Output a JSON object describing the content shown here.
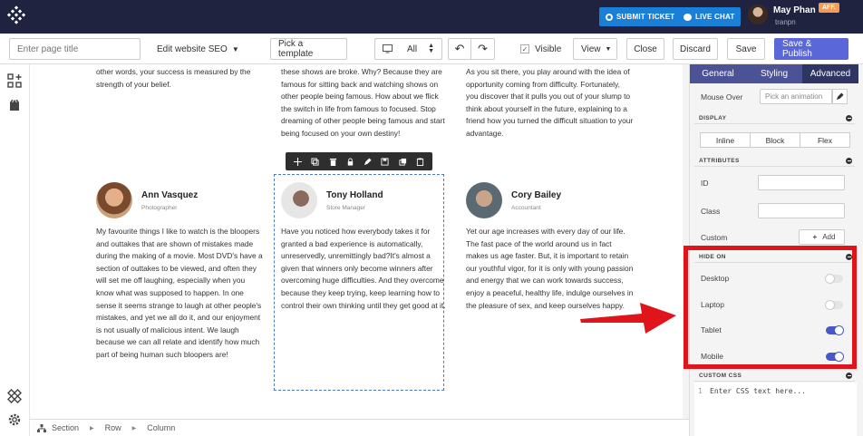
{
  "header": {
    "submit_ticket": "SUBMIT TICKET",
    "live_chat": "LIVE CHAT",
    "user_name": "May Phan",
    "user_handle": "tranpn",
    "badge": "AFF."
  },
  "toolbar": {
    "page_title_placeholder": "Enter page title",
    "seo_label": "Edit website SEO",
    "template_label": "Pick a template",
    "device_label": "All",
    "visible_label": "Visible",
    "view_label": "View",
    "close_label": "Close",
    "discard_label": "Discard",
    "save_label": "Save",
    "save_publish_label": "Save & Publish"
  },
  "content": {
    "columns": [
      {
        "intro": "other words, your success is measured by the strength of your belief.",
        "name": "Ann Vasquez",
        "role": "Photographer",
        "body": "My favourite things I like to watch is the bloopers and outtakes that are shown of mistakes made during the making of a movie. Most DVD's have a section of outtakes to be viewed, and often they will set me off laughing, especially when you know what was supposed to happen. In one sense it seems strange to laugh at other people's mistakes, and yet we all do it, and our enjoyment is not usually of malicious intent. We laugh because we can all relate and identify how much part of being human such bloopers are!"
      },
      {
        "intro": "these shows are broke. Why? Because they are famous for sitting back and watching shows on other people being famous. How about we flick the switch in life from famous to focused. Stop dreaming of other people being famous and start being focused on your own destiny!",
        "name": "Tony Holland",
        "role": "Store Manager",
        "body": "Have you noticed how everybody takes it for granted a bad experience is automatically, unreservedly, unremittingly bad?It's almost a given that winners only become winners after overcoming huge difficulties. And they overcome because they keep trying, keep learning how to control their own thinking until they get good at it."
      },
      {
        "intro": "As you sit there, you play around with the idea of opportunity coming from difficulty. Fortunately, you discover that it pulls you out of your slump to think about yourself in the future, explaining to a friend how you turned the difficult situation to your advantage.",
        "name": "Cory Bailey",
        "role": "Accountant",
        "body": "Yet our age increases with every day of our life. The fast pace of the world around us in fact makes us age faster. But, it is important to retain our youthful vigor, for it is only with young passion and energy that we can work towards success, enjoy a peaceful, healthy life, indulge ourselves in the pleasure of sex, and keep ourselves happy."
      }
    ]
  },
  "breadcrumb": [
    "Section",
    "Row",
    "Column"
  ],
  "panel": {
    "tabs": [
      "General",
      "Styling",
      "Advanced"
    ],
    "mouse_over_label": "Mouse Over",
    "animation_placeholder": "Pick an animation",
    "display_title": "DISPLAY",
    "display_options": [
      "Inline",
      "Block",
      "Flex"
    ],
    "attributes_title": "ATTRIBUTES",
    "id_label": "ID",
    "class_label": "Class",
    "custom_label": "Custom",
    "add_label": "Add",
    "hide_on_title": "HIDE ON",
    "hide_on": [
      {
        "label": "Desktop",
        "on": false
      },
      {
        "label": "Laptop",
        "on": false
      },
      {
        "label": "Tablet",
        "on": true
      },
      {
        "label": "Mobile",
        "on": true
      }
    ],
    "custom_css_title": "CUSTOM CSS",
    "css_line_number": "1",
    "css_placeholder": "Enter CSS text here..."
  },
  "colors": {
    "topbar": "#1f2340",
    "accent": "#5a67d8",
    "highlight": "#e0151b"
  }
}
